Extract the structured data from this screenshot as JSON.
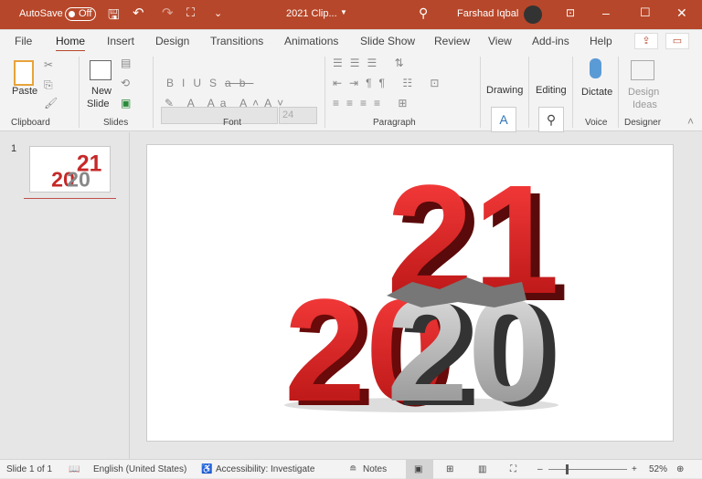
{
  "titlebar": {
    "autosave": "AutoSave",
    "autosave_state": "Off",
    "doc_title": "2021 Clip...",
    "user": "Farshad Iqbal",
    "color": "#b7472a"
  },
  "tabs": [
    "File",
    "Home",
    "Insert",
    "Design",
    "Transitions",
    "Animations",
    "Slide Show",
    "Review",
    "View",
    "Add-ins",
    "Help"
  ],
  "ribbon": {
    "paste": "Paste",
    "new_slide_1": "New",
    "new_slide_2": "Slide",
    "font_size": "24",
    "drawing": "Drawing",
    "editing": "Editing",
    "dictate": "Dictate",
    "design_ideas_1": "Design",
    "design_ideas_2": "Ideas",
    "groups": [
      "Clipboard",
      "Slides",
      "Font",
      "Paragraph",
      "Voice",
      "Designer"
    ]
  },
  "thumbs": {
    "number": "1"
  },
  "slide": {
    "top_number": "21",
    "bottom_number": "2020"
  },
  "status": {
    "slide": "Slide 1 of 1",
    "language": "English (United States)",
    "accessibility": "Accessibility: Investigate",
    "notes": "Notes",
    "zoom": "52%",
    "zoom_level": 52
  }
}
